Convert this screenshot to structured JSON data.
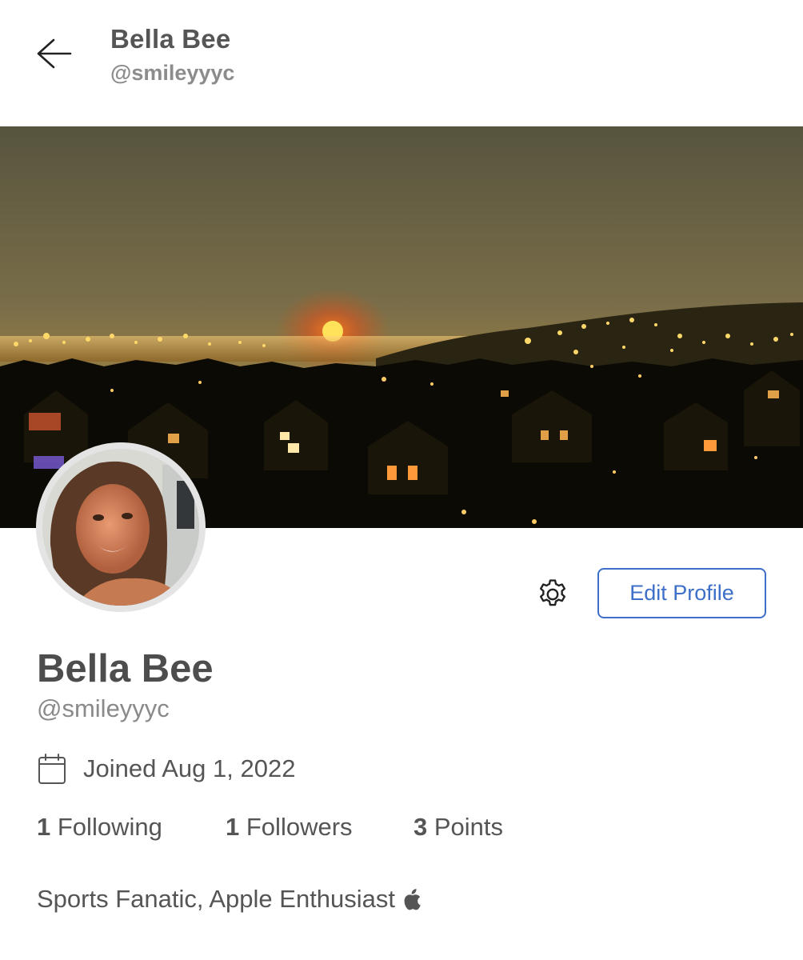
{
  "header": {
    "back_icon": "arrow-left-icon",
    "name": "Bella Bee",
    "handle": "@smileyyyc"
  },
  "banner": {
    "description_icon": "cover-photo-city-night-moon"
  },
  "avatar": {
    "icon": "profile-photo"
  },
  "actions": {
    "settings_icon": "gear-icon",
    "edit_profile_label": "Edit Profile",
    "accent_color": "#3d6fc9"
  },
  "profile": {
    "name": "Bella Bee",
    "handle": "@smileyyyc",
    "joined_icon": "calendar-icon",
    "joined": "Joined Aug 1, 2022",
    "stats": {
      "following_count": "1",
      "following_label": "Following",
      "followers_count": "1",
      "followers_label": "Followers",
      "points_count": "3",
      "points_label": "Points"
    },
    "bio": "Sports Fanatic, Apple Enthusiast",
    "bio_icon": "apple-icon"
  }
}
